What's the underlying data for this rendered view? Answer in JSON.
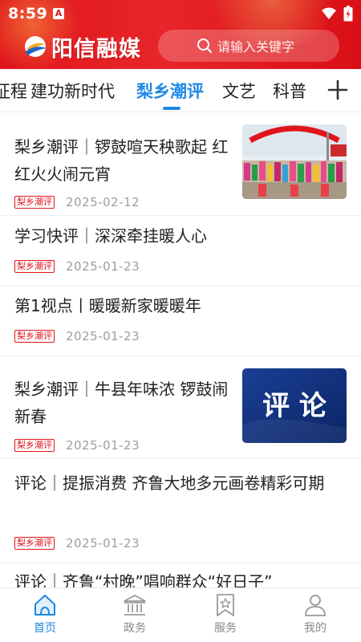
{
  "status_bar": {
    "time": "8:59",
    "notification_icon_label": "A"
  },
  "header": {
    "logo_text": "阳信融媒",
    "search_placeholder": "请输入关键字",
    "brand_color": "#e0151b"
  },
  "tabs": {
    "items": [
      "征程",
      "建功新时代",
      "梨乡潮评",
      "文艺",
      "科普"
    ],
    "active_index": 2,
    "active_color": "#1e88e5"
  },
  "news": [
    {
      "title": "梨乡潮评｜锣鼓喧天秧歌起 红红火火闹元宵",
      "tag": "梨乡潮评",
      "date": "2025-02-12",
      "has_image": true
    },
    {
      "title": "学习快评｜深深牵挂暖人心",
      "tag": "梨乡潮评",
      "date": "2025-01-23",
      "has_image": false
    },
    {
      "title": "第1视点丨暖暖新家暖暖年",
      "tag": "梨乡潮评",
      "date": "2025-01-23",
      "has_image": false
    },
    {
      "title": "梨乡潮评｜牛县年味浓 锣鼓闹新春",
      "tag": "梨乡潮评",
      "date": "2025-01-23",
      "has_image": true,
      "image_text": "评 论"
    },
    {
      "title": "评论｜提振消费 齐鲁大地多元画卷精彩可期",
      "tag": "梨乡潮评",
      "date": "2025-01-23",
      "has_image": false
    },
    {
      "title": "评论｜齐鲁“村晚”唱响群众“好日子”",
      "has_image": false
    }
  ],
  "bottom_nav": {
    "items": [
      {
        "label": "首页",
        "icon": "home-icon"
      },
      {
        "label": "政务",
        "icon": "government-building-icon"
      },
      {
        "label": "服务",
        "icon": "bookmark-star-icon"
      },
      {
        "label": "我的",
        "icon": "user-icon"
      }
    ],
    "active_index": 0
  }
}
